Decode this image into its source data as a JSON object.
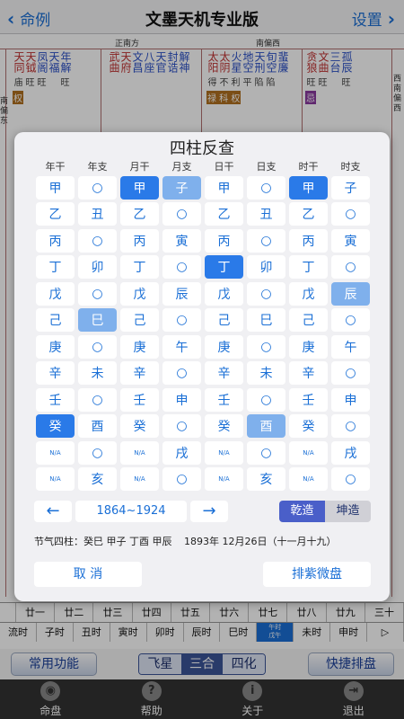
{
  "nav": {
    "back_label": "命例",
    "title": "文墨天机专业版",
    "settings_label": "设置"
  },
  "chart_bg": {
    "directions": [
      "正南方",
      "南偏西",
      "西南"
    ],
    "side_left": [
      "东",
      "南",
      "偏",
      "东"
    ],
    "side_right": [
      "西",
      "南",
      "偏",
      "西"
    ],
    "palaces": [
      {
        "stars": [
          "天同",
          "天钺",
          "凤阁",
          "天福",
          "年解"
        ],
        "brights": [
          "庙",
          "旺",
          "旺",
          "",
          "旺"
        ],
        "hua": "权",
        "small": [
          "年",
          "日",
          "月"
        ]
      },
      {
        "stars": [
          "武曲",
          "天府",
          "文昌",
          "八座",
          "天官",
          "封诰",
          "解神",
          "副截",
          "天空",
          "孤辰",
          "",
          "",
          ""
        ],
        "brights": [],
        "hua": "",
        "small": []
      },
      {
        "stars": [
          "太阳",
          "太阴",
          "火星",
          "地空",
          "天刑",
          "旬空",
          "蜚廉"
        ],
        "brights": [
          "得",
          "不",
          "利",
          "平",
          "陷",
          "陷"
        ],
        "hua": "禄 科 权",
        "small": []
      },
      {
        "stars": [
          "贪狼",
          "文曲",
          "三台",
          "孤辰"
        ],
        "brights": [
          "旺",
          "旺",
          "",
          "旺"
        ],
        "hua": "忌",
        "small": []
      }
    ]
  },
  "modal": {
    "title": "四柱反查",
    "column_headers": [
      "年干",
      "年支",
      "月干",
      "月支",
      "日干",
      "日支",
      "时干",
      "时支"
    ],
    "grid": [
      [
        "甲",
        "○",
        "甲",
        "子",
        "甲",
        "○",
        "甲",
        "子"
      ],
      [
        "乙",
        "丑",
        "乙",
        "○",
        "乙",
        "丑",
        "乙",
        "○"
      ],
      [
        "丙",
        "○",
        "丙",
        "寅",
        "丙",
        "○",
        "丙",
        "寅"
      ],
      [
        "丁",
        "卯",
        "丁",
        "○",
        "丁",
        "卯",
        "丁",
        "○"
      ],
      [
        "戊",
        "○",
        "戊",
        "辰",
        "戊",
        "○",
        "戊",
        "辰"
      ],
      [
        "己",
        "巳",
        "己",
        "○",
        "己",
        "巳",
        "己",
        "○"
      ],
      [
        "庚",
        "○",
        "庚",
        "午",
        "庚",
        "○",
        "庚",
        "午"
      ],
      [
        "辛",
        "未",
        "辛",
        "○",
        "辛",
        "未",
        "辛",
        "○"
      ],
      [
        "壬",
        "○",
        "壬",
        "申",
        "壬",
        "○",
        "壬",
        "申"
      ],
      [
        "癸",
        "酉",
        "癸",
        "○",
        "癸",
        "酉",
        "癸",
        "○"
      ],
      [
        "N/A",
        "○",
        "N/A",
        "戌",
        "N/A",
        "○",
        "N/A",
        "戌"
      ],
      [
        "N/A",
        "亥",
        "N/A",
        "○",
        "N/A",
        "亥",
        "N/A",
        "○"
      ]
    ],
    "selected": {
      "year_stem": "癸",
      "year_branch": "巳",
      "month_stem": "甲",
      "month_branch": "子",
      "day_stem": "丁",
      "day_branch": "酉",
      "hour_stem": "甲",
      "hour_branch": "辰"
    },
    "range_prev": "←",
    "range_label": "1864~1924",
    "range_next": "→",
    "gender_male": "乾造",
    "gender_female": "坤造",
    "gender_selected": "乾造",
    "jieqi_label": "节气四柱：癸巳 甲子 丁酉 甲辰",
    "result_date": "1893年 12月26日（十一月十九）",
    "cancel_label": "取 消",
    "submit_label": "排紫微盘"
  },
  "day_strip": [
    "廿一",
    "廿二",
    "廿三",
    "廿四",
    "廿五",
    "廿六",
    "廿七",
    "廿八",
    "廿九",
    "三十"
  ],
  "hour_strip": [
    "流时",
    "子时",
    "丑时",
    "寅时",
    "卯时",
    "辰时",
    "巳时",
    "午时\n戊午",
    "未时",
    "申时",
    "▷"
  ],
  "function_bar": {
    "common_label": "常用功能",
    "seg": [
      "飞星",
      "三合",
      "四化"
    ],
    "seg_active": "三合",
    "quick_label": "快捷排盘"
  },
  "tabs": [
    {
      "label": "命盘",
      "icon": "eye-icon",
      "glyph": "◉"
    },
    {
      "label": "帮助",
      "icon": "help-icon",
      "glyph": "?"
    },
    {
      "label": "关于",
      "icon": "info-icon",
      "glyph": "i"
    },
    {
      "label": "退出",
      "icon": "exit-icon",
      "glyph": "⇥"
    }
  ]
}
